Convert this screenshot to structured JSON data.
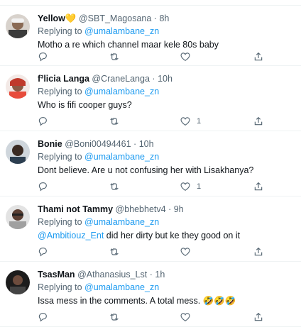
{
  "replying_label": "Replying to",
  "replying_handle": "@umalambane_zn",
  "tweets": [
    {
      "name": "Yellow",
      "name_emoji": "💛",
      "handle": "@SBT_Magosana",
      "dot": "·",
      "time": "8h",
      "text": "Motho a re which channel maar kele 80s baby",
      "likes": ""
    },
    {
      "name": "f³licia Langa",
      "handle": "@CraneLanga",
      "dot": "·",
      "time": "10h",
      "text": "Who is fifi cooper guys?",
      "likes": "1"
    },
    {
      "name": "Bonie",
      "handle": "@Boni00494461",
      "dot": "·",
      "time": "10h",
      "text": "Dont believe. Are u not confusing her with Lisakhanya?",
      "likes": "1"
    },
    {
      "name": "Thami not Tammy",
      "handle": "@bhebhetv4",
      "dot": "·",
      "time": "9h",
      "mention": "@Ambitiouz_Ent",
      "text": " did her dirty but ke they good on it",
      "likes": ""
    },
    {
      "name": "TsasMan",
      "handle": "@Athanasius_Lst",
      "dot": "·",
      "time": "1h",
      "text": "Issa mess in the comments.  A total mess. 🤣🤣🤣",
      "likes": ""
    }
  ],
  "colors": {
    "accent": "#1d9bf0",
    "muted": "#536471",
    "text": "#0f1419"
  },
  "icons": [
    "reply-icon",
    "retweet-icon",
    "like-icon",
    "share-icon"
  ]
}
